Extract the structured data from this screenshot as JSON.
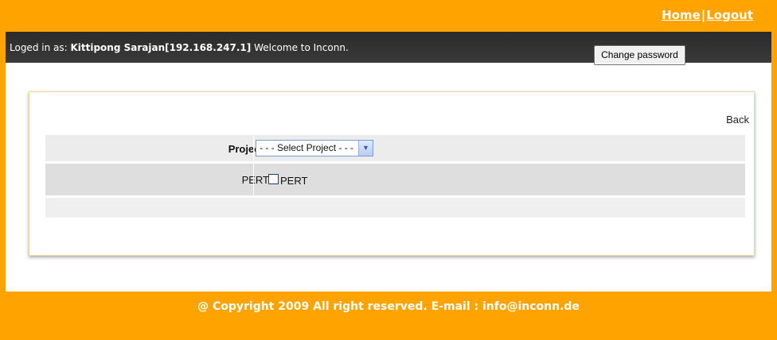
{
  "nav": {
    "home": "Home",
    "separator": "|",
    "logout": "Logout"
  },
  "header": {
    "login_prefix": "Loged in as: ",
    "user": "Kittipong Sarajan[192.168.247.1]",
    "welcome": " Welcome to Inconn.",
    "change_password": "Change password"
  },
  "content": {
    "back": "Back",
    "project_label": "Project",
    "project_colon": " :",
    "project_selected": "- - - Select Project - - -",
    "pert_label": "PERT",
    "pert_checkbox_label": "PERT",
    "pert_checked": false
  },
  "footer": {
    "copyright": "@ Copyright 2009 All right reserved. E-mail : info@inconn.de"
  },
  "colors": {
    "brand_orange": "#ffa300",
    "header_dark": "#2b2b2b"
  }
}
